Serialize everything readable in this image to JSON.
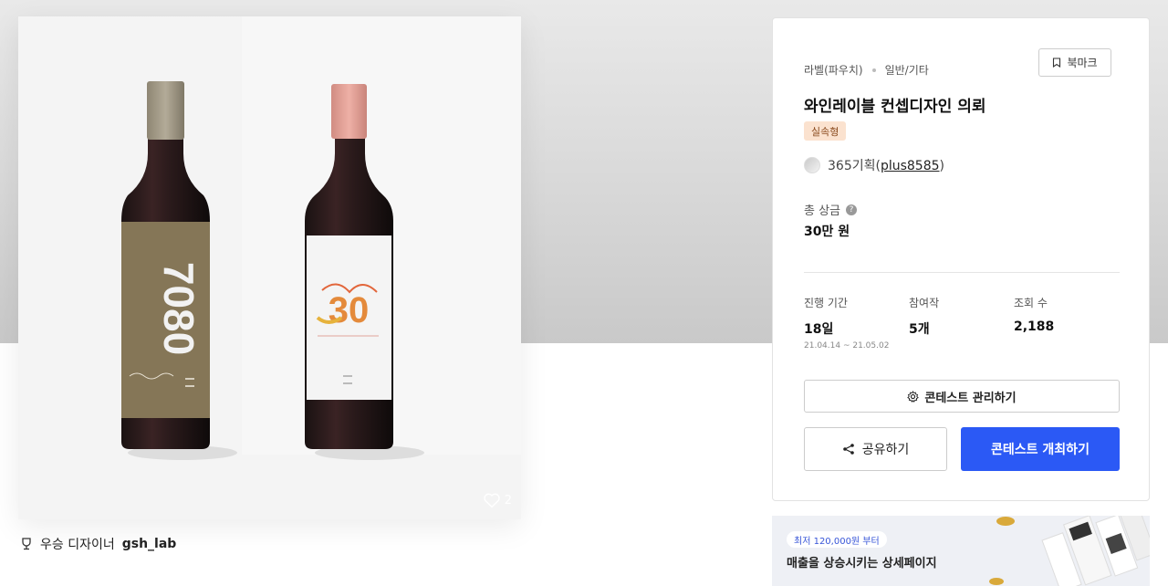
{
  "product": {
    "like_count": "2",
    "progress": 0.23
  },
  "winner": {
    "label": "우승 디자이너",
    "name": "gsh_lab"
  },
  "contest": {
    "category": "라벨(파우치)",
    "subcategory": "일반/기타",
    "bookmark_label": "북마크",
    "title": "와인레이블 컨셉디자인 의뢰",
    "type_badge": "실속형",
    "host_name": "365기획",
    "host_id": "plus8585",
    "prize_label": "총 상금",
    "prize_value": "30만 원",
    "stats": {
      "period_label": "진행 기간",
      "period_value": "18일",
      "period_range": "21.04.14 ~ 21.05.02",
      "entries_label": "참여작",
      "entries_value": "5개",
      "views_label": "조회 수",
      "views_value": "2,188"
    },
    "manage_label": "콘테스트 관리하기",
    "share_label": "공유하기",
    "open_label": "콘테스트 개최하기"
  },
  "ad": {
    "pill": "최저 120,000원 부터",
    "headline": "매출을 상승시키는 상세페이지"
  },
  "colors": {
    "primary": "#2b59f5",
    "badge_bg": "#fbe2cf",
    "label_olive": "#857657",
    "cap_pink": "#e8a49b"
  }
}
